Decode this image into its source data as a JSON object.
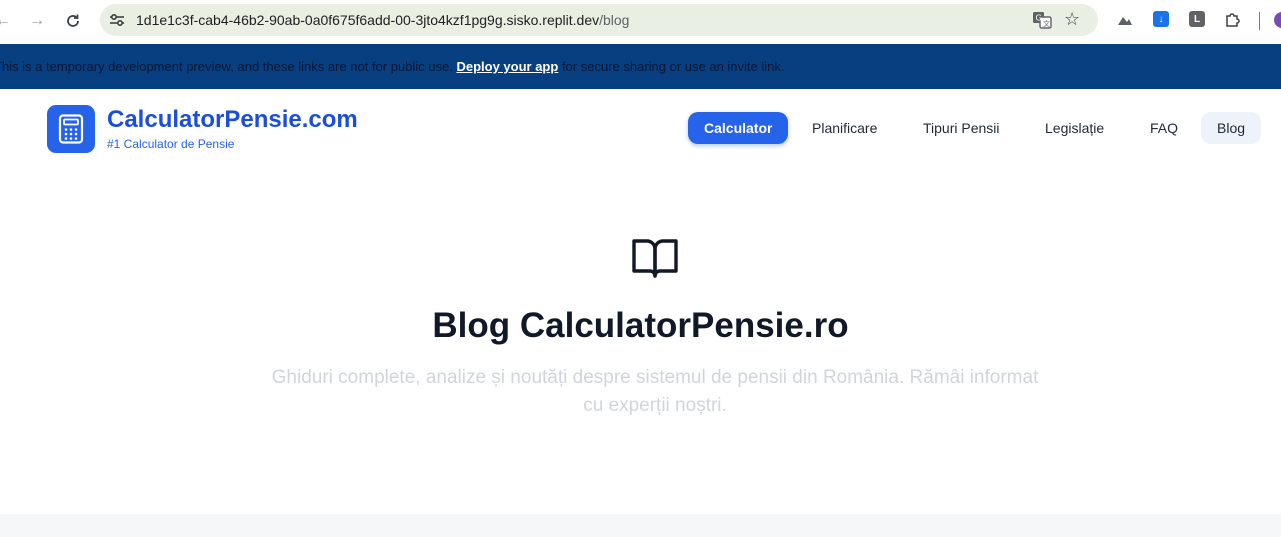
{
  "browser": {
    "url_host": "1d1e1c3f-cab4-46b2-90ab-0a0f675f6add-00-3jto4kzf1pg9g.sisko.replit.dev",
    "url_path": "/blog",
    "icons": {
      "back": "arrow-left-icon",
      "forward": "arrow-right-icon",
      "reload": "reload-icon",
      "site_info": "tune-icon",
      "translate": "translate-icon",
      "bookmark": "star-icon",
      "extensions": "puzzle-icon"
    },
    "ext_letter_l": "L"
  },
  "dev_banner": {
    "text_before": "This is a temporary development preview, and these links are not for public use. ",
    "link_label": "Deploy your app",
    "text_after": " for secure sharing or use an invite link."
  },
  "header": {
    "brand_name": "CalculatorPensie.com",
    "tagline": "#1 Calculator de Pensie",
    "logo_icon": "calculator-icon",
    "nav": [
      {
        "label": "Calculator"
      },
      {
        "label": "Planificare"
      },
      {
        "label": "Tipuri Pensii"
      },
      {
        "label": "Legislație"
      },
      {
        "label": "FAQ"
      },
      {
        "label": "Blog"
      }
    ]
  },
  "hero": {
    "icon": "book-open-icon",
    "title": "Blog CalculatorPensie.ro",
    "subtitle": "Ghiduri complete, analize și noutăți despre sistemul de pensii din România. Rămâi informat cu experții noștri."
  },
  "colors": {
    "primary": "#2563eb",
    "banner": "#073f80",
    "title": "#111827",
    "subtitle": "#d1d5db"
  }
}
